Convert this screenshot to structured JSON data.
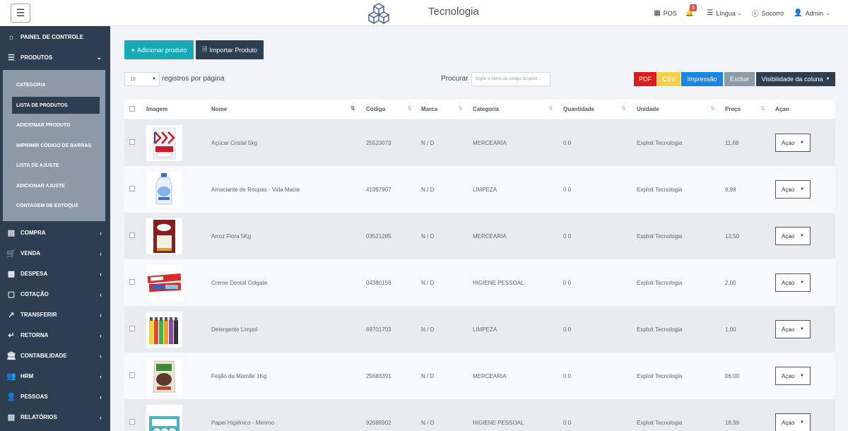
{
  "header": {
    "menu_icon": "hamburger-icon",
    "brand": "Tecnologia",
    "pos": "POS",
    "notifications_count": "3",
    "language": "Língua",
    "help": "Socorro",
    "user": "Admin"
  },
  "sidebar": {
    "items": [
      {
        "label": "PAINEL DE CONTROLE",
        "icon": "dashboard-icon"
      },
      {
        "label": "PRODUTOS",
        "icon": "list-icon"
      },
      {
        "label": "COMPRA",
        "icon": "card-icon"
      },
      {
        "label": "VENDA",
        "icon": "cart-icon"
      },
      {
        "label": "DESPESA",
        "icon": "wallet-icon"
      },
      {
        "label": "COTAÇÃO",
        "icon": "document-icon"
      },
      {
        "label": "TRANSFERIR",
        "icon": "transfer-icon"
      },
      {
        "label": "RETORNA",
        "icon": "return-icon"
      },
      {
        "label": "CONTABILIDADE",
        "icon": "bank-icon"
      },
      {
        "label": "HRM",
        "icon": "users-icon"
      },
      {
        "label": "PESSOAS",
        "icon": "person-icon"
      },
      {
        "label": "RELATÓRIOS",
        "icon": "report-icon"
      }
    ],
    "sub_items": [
      {
        "label": "CATEGORIA"
      },
      {
        "label": "LISTA DE PRODUTOS"
      },
      {
        "label": "ADICIONAR PRODUTO"
      },
      {
        "label": "IMPRIMIR CÓDIGO DE BARRAS"
      },
      {
        "label": "LISTA DE AJUSTE"
      },
      {
        "label": "ADICIONAR AJUSTE"
      },
      {
        "label": "CONTAGEM DE ESTOQUE"
      }
    ]
  },
  "toolbar": {
    "add_label": "Adicionar produto",
    "import_label": "Importar Produto",
    "page_length": "10",
    "page_length_label": "registros por página",
    "search_label": "Procurar",
    "search_placeholder": "Digite o nome ou código do prod...",
    "pdf": "PDF",
    "csv": "CSV",
    "print": "Impressão",
    "delete": "Excluir",
    "col_visibility": "Visibilidade da coluna"
  },
  "table": {
    "headers": {
      "image": "Imagem",
      "name": "Nome",
      "code": "Código",
      "brand": "Marca",
      "category": "Categoria",
      "quantity": "Quantidade",
      "unit": "Unidade",
      "price": "Preço",
      "action": "Açao"
    },
    "rows": [
      {
        "name": "Açúcar Cristal 5kg",
        "code": "25523073",
        "brand": "N / D",
        "category": "MERCEARIA",
        "quantity": "0 0",
        "unit": "Exploit Tecnologia",
        "price": "11,68",
        "action": "Açao"
      },
      {
        "name": "Amaciante de Roupas - Vida Macia",
        "code": "41397907",
        "brand": "N / D",
        "category": "LIMPEZA",
        "quantity": "0 0",
        "unit": "Exploit Tecnologia",
        "price": "9,98",
        "action": "Açao"
      },
      {
        "name": "Arroz Flora 5Kg",
        "code": "03521285",
        "brand": "N / D",
        "category": "MERCEARIA",
        "quantity": "0 0",
        "unit": "Exploit Tecnologia",
        "price": "13,50",
        "action": "Açao"
      },
      {
        "name": "Creme Dental Colgate",
        "code": "04380156",
        "brand": "N / D",
        "category": "HIGIENE PESSOAL",
        "quantity": "0 0",
        "unit": "Exploit Tecnologia",
        "price": "2,00",
        "action": "Açao"
      },
      {
        "name": "Detergente Limpol",
        "code": "69701703",
        "brand": "N / D",
        "category": "LIMPEZA",
        "quantity": "0 0",
        "unit": "Exploit Tecnologia",
        "price": "1,00",
        "action": "Açao"
      },
      {
        "name": "Feijão da Mamãe 1Kg",
        "code": "25683391",
        "brand": "N / D",
        "category": "MERCEARIA",
        "quantity": "0 0",
        "unit": "Exploit Tecnologia",
        "price": "06.00",
        "action": "Açao"
      },
      {
        "name": "Papel Higiênico - Mimmo",
        "code": "92688902",
        "brand": "N / D",
        "category": "HIGIENE PESSOAL",
        "quantity": "0 0",
        "unit": "Exploit Tecnologia",
        "price": "18,99",
        "action": "Açao"
      }
    ]
  },
  "colors": {
    "sidebar": "#2d3e50",
    "submenu": "#8d9aa8",
    "accent": "#18a9b7",
    "pdf": "#dc1c1c",
    "csv": "#f7d04a",
    "print": "#1b86e0"
  }
}
